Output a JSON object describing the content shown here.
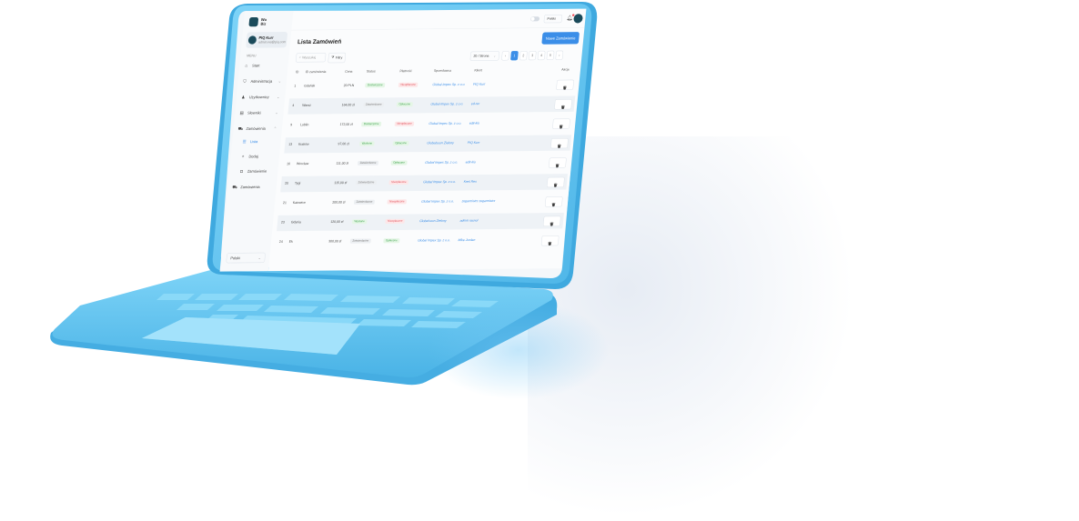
{
  "app": {
    "logo_text": "Wo\nBiz"
  },
  "user": {
    "name": "PIQ Kurr",
    "email": "admin.ws@piq.com"
  },
  "sidebar": {
    "menu_heading": "MENU",
    "items": [
      {
        "label": "Start",
        "icon": "home-icon"
      },
      {
        "label": "Administracja",
        "icon": "shield-icon",
        "chevron": true
      },
      {
        "label": "Użytkownicy",
        "icon": "user-icon",
        "chevron": true
      },
      {
        "label": "Słowniki",
        "icon": "book-icon",
        "chevron": true
      },
      {
        "label": "Zamówienia",
        "icon": "cart-icon",
        "chevron": true,
        "expanded": true
      },
      {
        "label": "Lista",
        "icon": "list-icon",
        "sub": true,
        "active": true
      },
      {
        "label": "Dodaj",
        "icon": "plus-icon",
        "sub": true
      },
      {
        "label": "Zamówienie",
        "icon": "package-icon",
        "sub": true
      },
      {
        "label": "Zamówienia",
        "icon": "cart-icon"
      }
    ],
    "language": "Polski"
  },
  "topbar": {
    "select_value": "Polski",
    "notifications": true
  },
  "page": {
    "title": "Lista Zamówień",
    "new_button": "Nowe Zamówienie",
    "search_placeholder": "Wyszukaj",
    "filter_label": "Filtry",
    "page_size": "20 / Strona",
    "pages": [
      "1",
      "2",
      "3",
      "4",
      "5"
    ],
    "current_page": 1
  },
  "table": {
    "headers": [
      "ID",
      "ID zamówienia",
      "Cena",
      "Status",
      "Płatność",
      "Sprzedawca",
      "Klient",
      "Akcje"
    ],
    "rows": [
      {
        "id": "1",
        "order": "Gdańsk",
        "price": "20 PLN",
        "status": "Dostarczone",
        "status_color": "green",
        "payment": "Nieopłacone",
        "payment_color": "red",
        "seller": "Global Impex Sp. z o.o.",
        "client": "PIQ Kurr"
      },
      {
        "id": "4",
        "order": "Warsz",
        "price": "164,00 zł",
        "status": "Zatwierdzone",
        "status_color": "grey",
        "payment": "Opłacone",
        "payment_color": "green",
        "seller": "Global Impex Sp. z o.o.",
        "client": "ed-rer"
      },
      {
        "id": "9",
        "order": "Lublin",
        "price": "172,00 zł",
        "status": "Dostarczone",
        "status_color": "green",
        "payment": "Nieopłacone",
        "payment_color": "red",
        "seller": "Global Impex Sp. z o.o.",
        "client": "edit-kio"
      },
      {
        "id": "13",
        "order": "Kraków",
        "price": "97,00 zł",
        "status": "Wysłane",
        "status_color": "green",
        "payment": "Opłacone",
        "payment_color": "green",
        "seller": "Globalsoon Zielony",
        "client": "PIQ Kurr"
      },
      {
        "id": "16",
        "order": "Wrocław",
        "price": "111,00 zł",
        "status": "Zatwierdzone",
        "status_color": "grey",
        "payment": "Opłacone",
        "payment_color": "green",
        "seller": "Global Impex Sp. z o.o.",
        "client": "edit-kio"
      },
      {
        "id": "20",
        "order": "Tygi",
        "price": "115,00 zł",
        "status": "Zatwierdzone",
        "status_color": "grey",
        "payment": "Nieopłacone",
        "payment_color": "red",
        "seller": "Global Impex Sp. z o.o.",
        "client": "Kreš Res"
      },
      {
        "id": "21",
        "order": "Katowice",
        "price": "200,00 zł",
        "status": "Zatwierdzone",
        "status_color": "grey",
        "payment": "Nieopłacone",
        "payment_color": "red",
        "seller": "Global Impex Sp. z o.o.",
        "client": "zegarmistrz zegarmistrz"
      },
      {
        "id": "23",
        "order": "Gdynia",
        "price": "120,00 zł",
        "status": "Wysłane",
        "status_color": "green",
        "payment": "Nieopłacone",
        "payment_color": "red",
        "seller": "Globalsoon Zielony",
        "client": "admin rasnol"
      },
      {
        "id": "24",
        "order": "Ek",
        "price": "300,00 zł",
        "status": "Zatwierdzone",
        "status_color": "grey",
        "payment": "Opłacone",
        "payment_color": "green",
        "seller": "Global Impex Sp. z o.o.",
        "client": "Mike Jordan"
      }
    ]
  },
  "colors": {
    "laptop_body": "#5bc0ee",
    "accent": "#3b8ee8"
  }
}
